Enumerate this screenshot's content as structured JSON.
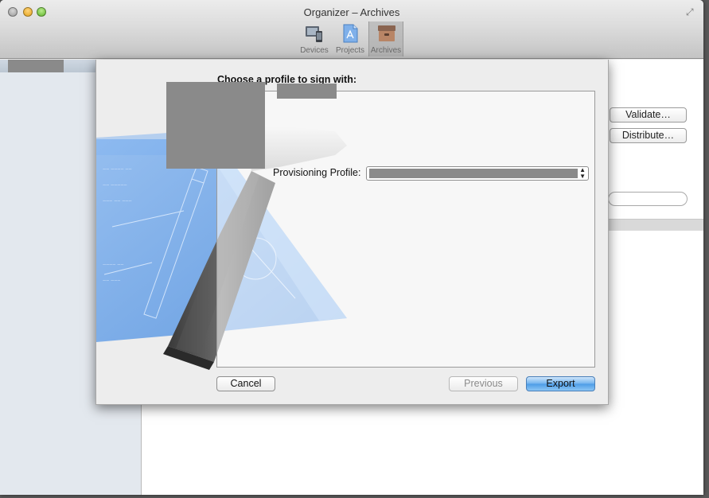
{
  "window": {
    "title": "Organizer – Archives"
  },
  "toolbar": {
    "items": [
      {
        "label": "Devices",
        "icon": "devices-icon"
      },
      {
        "label": "Projects",
        "icon": "projects-icon"
      },
      {
        "label": "Archives",
        "icon": "archives-icon",
        "selected": true
      }
    ]
  },
  "main": {
    "validate_label": "Validate…",
    "distribute_label": "Distribute…"
  },
  "sheet": {
    "heading": "Choose a profile to sign with:",
    "provisioning_label": "Provisioning Profile:",
    "cancel_label": "Cancel",
    "previous_label": "Previous",
    "export_label": "Export"
  },
  "colors": {
    "accent": "#4c9be6",
    "sidebar": "#e3e8ee",
    "art_blue": "#6fa4e6"
  }
}
